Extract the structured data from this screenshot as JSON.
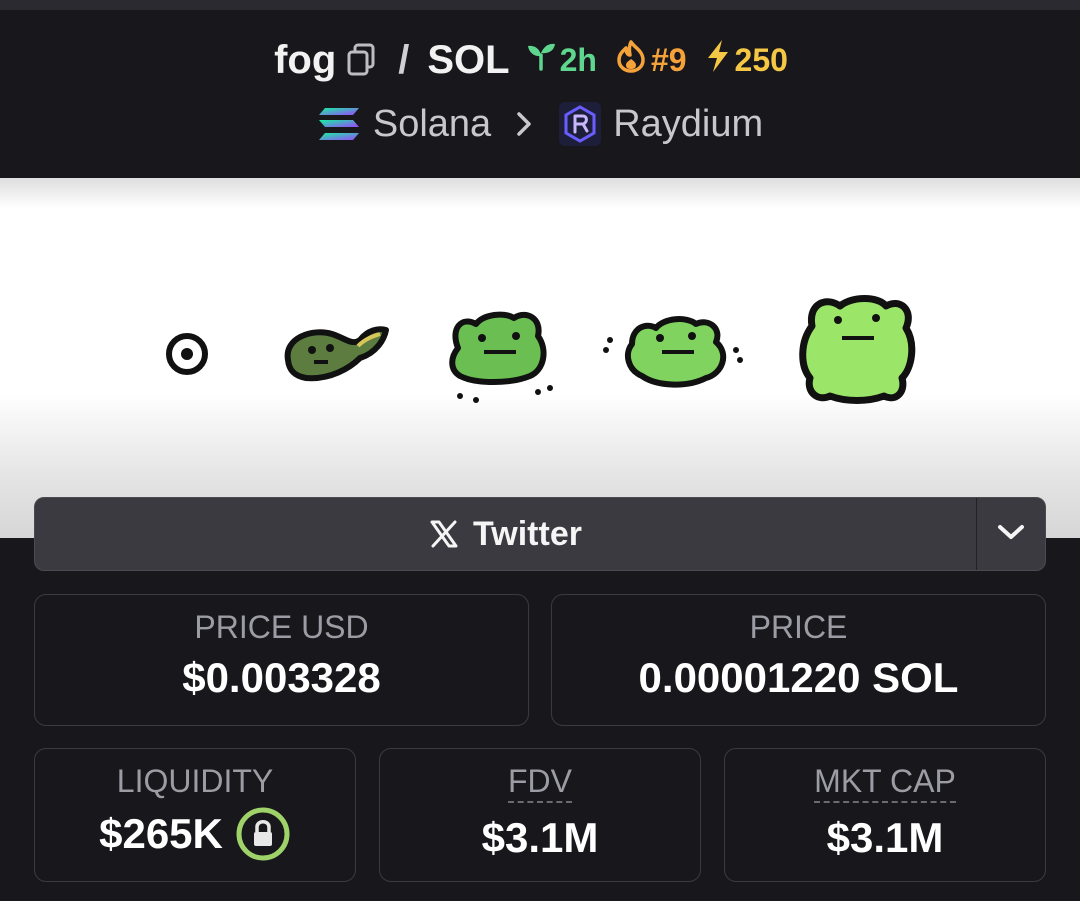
{
  "header": {
    "base_symbol": "fog",
    "separator": "/",
    "quote_symbol": "SOL",
    "age": "2h",
    "trending_rank": "#9",
    "boosts": "250",
    "chain": "Solana",
    "dex": "Raydium"
  },
  "social": {
    "twitter_label": "Twitter"
  },
  "stats": {
    "price_usd_label": "PRICE USD",
    "price_usd_value": "$0.003328",
    "price_label": "PRICE",
    "price_value": "0.00001220 SOL",
    "liquidity_label": "LIQUIDITY",
    "liquidity_value": "$265K",
    "fdv_label": "FDV",
    "fdv_value": "$3.1M",
    "mktcap_label": "MKT CAP",
    "mktcap_value": "$3.1M"
  },
  "colors": {
    "age": "#5fd68d",
    "rank": "#f5a23a",
    "boost": "#f6c744",
    "lock": "#9fd36a"
  }
}
